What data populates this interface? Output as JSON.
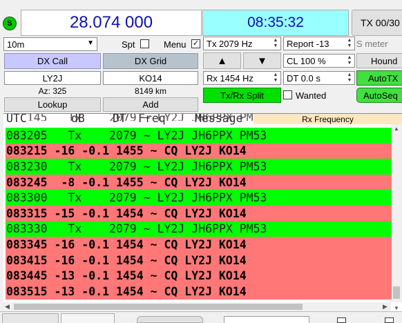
{
  "status": {
    "icon_letter": "S"
  },
  "frequency_display": "28.074 000",
  "clock_display": "08:35:32",
  "tx_counter": "TX 00/30",
  "band": {
    "value": "10m"
  },
  "spot": {
    "label": "Spt"
  },
  "menu": {
    "label": "Menu",
    "checked": "✓"
  },
  "dx_call": {
    "button": "DX Call",
    "value": "LY2J",
    "azimuth": "Az: 325",
    "lookup": "Lookup"
  },
  "dx_grid": {
    "button": "DX Grid",
    "value": "KO14",
    "distance": "8149 km",
    "add": "Add"
  },
  "tx_freq": "Tx  2079  Hz",
  "rx_freq": "Rx  1454  Hz",
  "arrows": {
    "up": "▲",
    "down": "▼"
  },
  "tx_rx_split": "Tx/Rx Split",
  "report": "Report -13",
  "cl": "CL  100 %",
  "dt": "DT  0.0 s",
  "wanted": {
    "label": "Wanted"
  },
  "s_meter": "S meter",
  "hound": "Hound",
  "autotx": "AutoTX",
  "autoseq": "AutoSeq",
  "colors": {
    "tx_row": "#00ff00",
    "rx_row": "#ff7777",
    "clock_bg": "#99ffff",
    "status_green": "#00c800"
  },
  "log": {
    "header_partial": "083145   Tx    2079 ~ LY2J JH6PPX PM53",
    "headers": [
      "UTC",
      "dB",
      "DT",
      "Freq",
      "Message"
    ],
    "rx_frequency_label": "Rx Frequency",
    "rows": [
      {
        "text": "083205   Tx    2079 ~ LY2J JH6PPX PM53",
        "type": "tx"
      },
      {
        "text": "083215 -16 -0.1 1455 ~ CQ LY2J KO14",
        "type": "rx"
      },
      {
        "text": "083230   Tx    2079 ~ LY2J JH6PPX PM53",
        "type": "tx"
      },
      {
        "text": "083245  -8 -0.1 1455 ~ CQ LY2J KO14",
        "type": "rx"
      },
      {
        "text": "083300   Tx    2079 ~ LY2J JH6PPX PM53",
        "type": "tx"
      },
      {
        "text": "083315 -15 -0.1 1454 ~ CQ LY2J KO14",
        "type": "rx"
      },
      {
        "text": "083330   Tx    2079 ~ LY2J JH6PPX PM53",
        "type": "tx"
      },
      {
        "text": "083345 -16 -0.1 1454 ~ CQ LY2J KO14",
        "type": "rx"
      },
      {
        "text": "083415 -16 -0.1 1454 ~ CQ LY2J KO14",
        "type": "rx"
      },
      {
        "text": "083445 -13 -0.1 1454 ~ CQ LY2J KO14",
        "type": "rx"
      },
      {
        "text": "083515 -13 -0.1 1454 ~ CQ LY2J KO14",
        "type": "rx"
      }
    ]
  }
}
